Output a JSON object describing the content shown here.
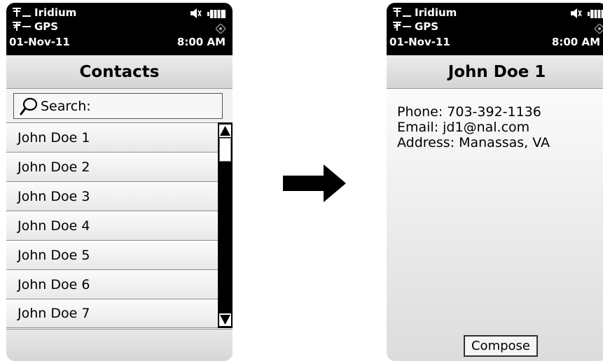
{
  "left_screen": {
    "status": {
      "iridium_label": "Iridium",
      "gps_label": "GPS",
      "date": "01-Nov-11",
      "time": "8:00 AM"
    },
    "title": "Contacts",
    "search_label": "Search:",
    "contacts": [
      "John Doe 1",
      "John Doe 2",
      "John Doe 3",
      "John Doe 4",
      "John Doe 5",
      "John Doe 6",
      "John Doe 7"
    ]
  },
  "right_screen": {
    "status": {
      "iridium_label": "Iridium",
      "gps_label": "GPS",
      "date": "01-Nov-11",
      "time": "8:00 AM"
    },
    "title": "John Doe 1",
    "details": {
      "phone": "Phone: 703-392-1136",
      "email": "Email: jd1@nal.com",
      "address": "Address: Manassas, VA"
    },
    "compose_label": "Compose"
  },
  "icons": {
    "satellite": "satellite-signal-icon",
    "mute": "speaker-mute-icon",
    "battery": "battery-icon",
    "gps_fix": "gps-fix-icon",
    "search": "magnifier-icon",
    "transition": "right-arrow-icon"
  },
  "colors": {
    "status_bar": "#000000",
    "status_text": "#ffffff",
    "arrow": "#000000"
  }
}
